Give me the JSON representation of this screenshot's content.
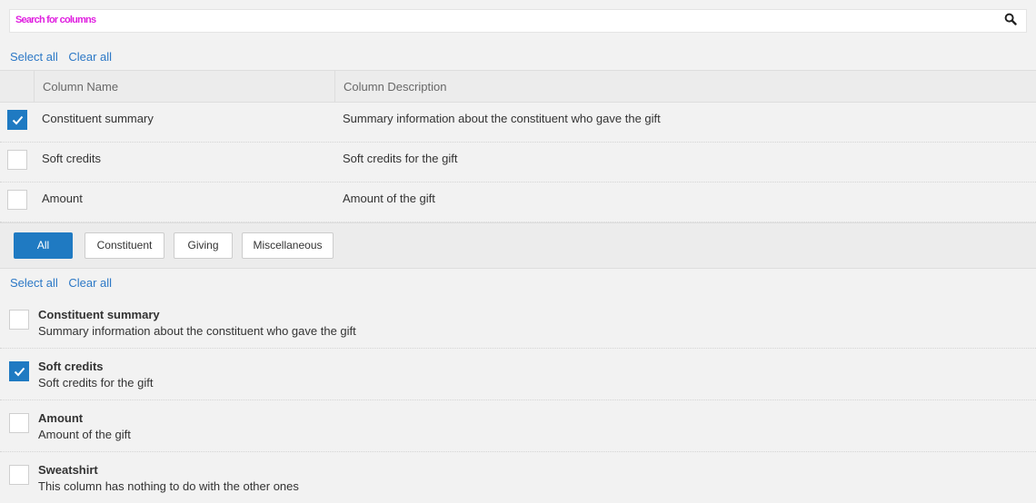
{
  "search": {
    "value": "Search for columns"
  },
  "top_links": {
    "select_all": "Select all",
    "clear_all": "Clear all"
  },
  "table": {
    "headers": {
      "name": "Column Name",
      "description": "Column Description"
    },
    "rows": [
      {
        "name": "Constituent summary",
        "description": "Summary information about the constituent who gave the gift",
        "checked": true
      },
      {
        "name": "Soft credits",
        "description": "Soft credits for the gift",
        "checked": false
      },
      {
        "name": "Amount",
        "description": "Amount of the gift",
        "checked": false
      }
    ]
  },
  "filters": [
    {
      "label": "All",
      "active": true
    },
    {
      "label": "Constituent",
      "active": false
    },
    {
      "label": "Giving",
      "active": false
    },
    {
      "label": "Miscellaneous",
      "active": false
    }
  ],
  "bottom_links": {
    "select_all": "Select all",
    "clear_all": "Clear all"
  },
  "list": [
    {
      "title": "Constituent summary",
      "description": "Summary information about the constituent who gave the gift",
      "checked": false
    },
    {
      "title": "Soft credits",
      "description": "Soft credits for the gift",
      "checked": true
    },
    {
      "title": "Amount",
      "description": "Amount of the gift",
      "checked": false
    },
    {
      "title": "Sweatshirt",
      "description": "This column has nothing to do with the other ones",
      "checked": false
    }
  ],
  "colors": {
    "accent": "#1f7ac2",
    "link": "#2c78c6",
    "search_text": "#e020e0"
  },
  "icons": {
    "search": "search-icon",
    "check": "checkmark-icon"
  }
}
